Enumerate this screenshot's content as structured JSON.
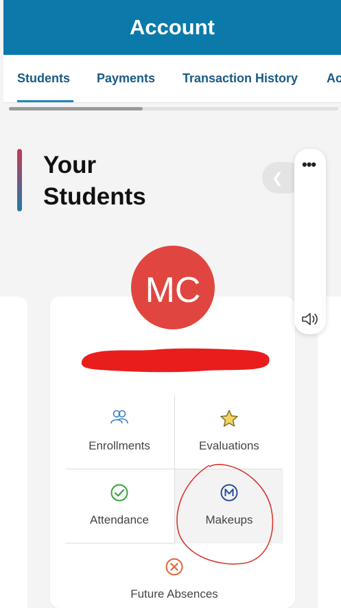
{
  "header": {
    "title": "Account",
    "color": "#0b7aab"
  },
  "tabs": [
    {
      "label": "Students",
      "active": true
    },
    {
      "label": "Payments",
      "active": false
    },
    {
      "label": "Transaction History",
      "active": false
    },
    {
      "label": "Ac",
      "active": false
    }
  ],
  "section": {
    "title_line1": "Your",
    "title_line2": "Students"
  },
  "floating_panel": {
    "menu_icon": "more-dots-icon",
    "sound_icon": "speaker-icon"
  },
  "student": {
    "initials": "MC",
    "avatar_color": "#e0463f"
  },
  "actions": {
    "enrollments": "Enrollments",
    "evaluations": "Evaluations",
    "attendance": "Attendance",
    "makeups": "Makeups",
    "future_absences": "Future Absences"
  }
}
